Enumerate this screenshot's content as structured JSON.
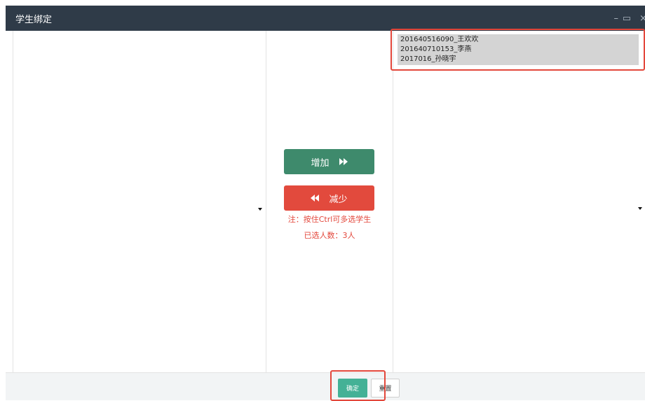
{
  "window": {
    "title": "学生绑定",
    "controls": {
      "minimize": "–",
      "maximize": "▭",
      "close": "×"
    }
  },
  "right_list": {
    "selected_items": [
      "201640516090_王欢欢",
      "201640710153_李燕",
      "2017016_孙晓宇"
    ]
  },
  "middle": {
    "add_label": "增加",
    "remove_label": "减少",
    "note": "注：按住Ctrl可多选学生",
    "selected_count": "已选人数：3人"
  },
  "footer": {
    "confirm_label": "确定",
    "reset_label": "重置"
  },
  "colors": {
    "titlebar": "#2f3b48",
    "add_button": "#3e8a6c",
    "remove_button": "#e24a3d",
    "confirm_button": "#44b196",
    "highlight": "#e3473b"
  },
  "icons": {
    "add": "double-chevron-right-icon",
    "remove": "double-chevron-left-icon"
  }
}
